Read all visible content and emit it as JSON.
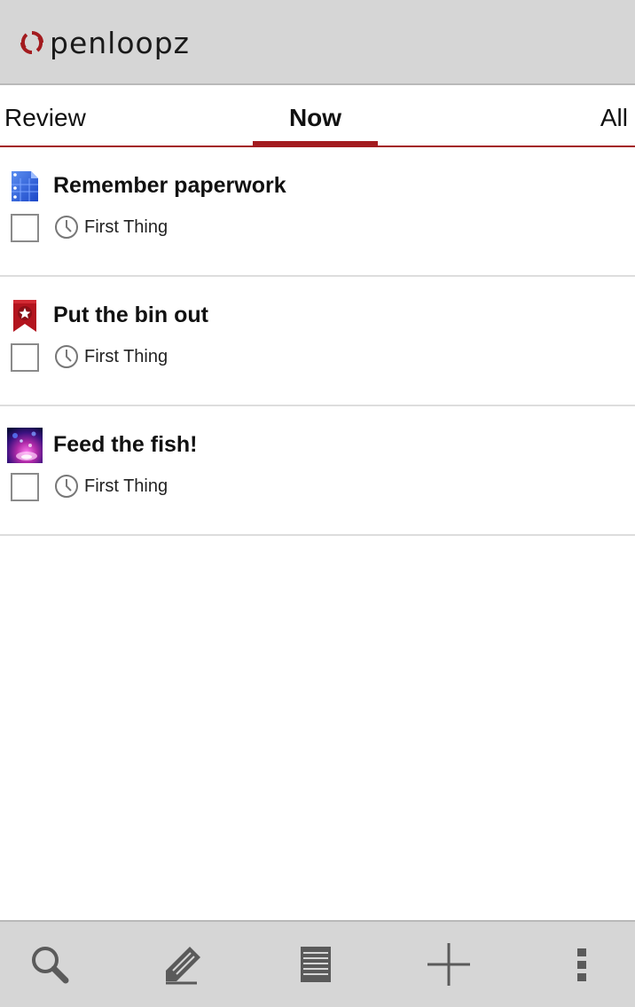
{
  "app": {
    "logo_text": "penloopz",
    "brand_color": "#a31b1f"
  },
  "tabs": [
    {
      "label": "Review",
      "selected": false
    },
    {
      "label": "Now",
      "selected": true
    },
    {
      "label": "All",
      "selected": false
    }
  ],
  "items": [
    {
      "title": "Remember paperwork",
      "icon": "document-icon",
      "when": "First Thing",
      "done": false
    },
    {
      "title": "Put the bin out",
      "icon": "bookmark-star-icon",
      "when": "First Thing",
      "done": false
    },
    {
      "title": "Feed the fish!",
      "icon": "photo-thumbnail-icon",
      "when": "First Thing",
      "done": false
    }
  ],
  "bottom_bar": {
    "buttons": [
      "search-icon",
      "edit-icon",
      "list-icon",
      "add-icon",
      "overflow-menu-icon"
    ]
  }
}
